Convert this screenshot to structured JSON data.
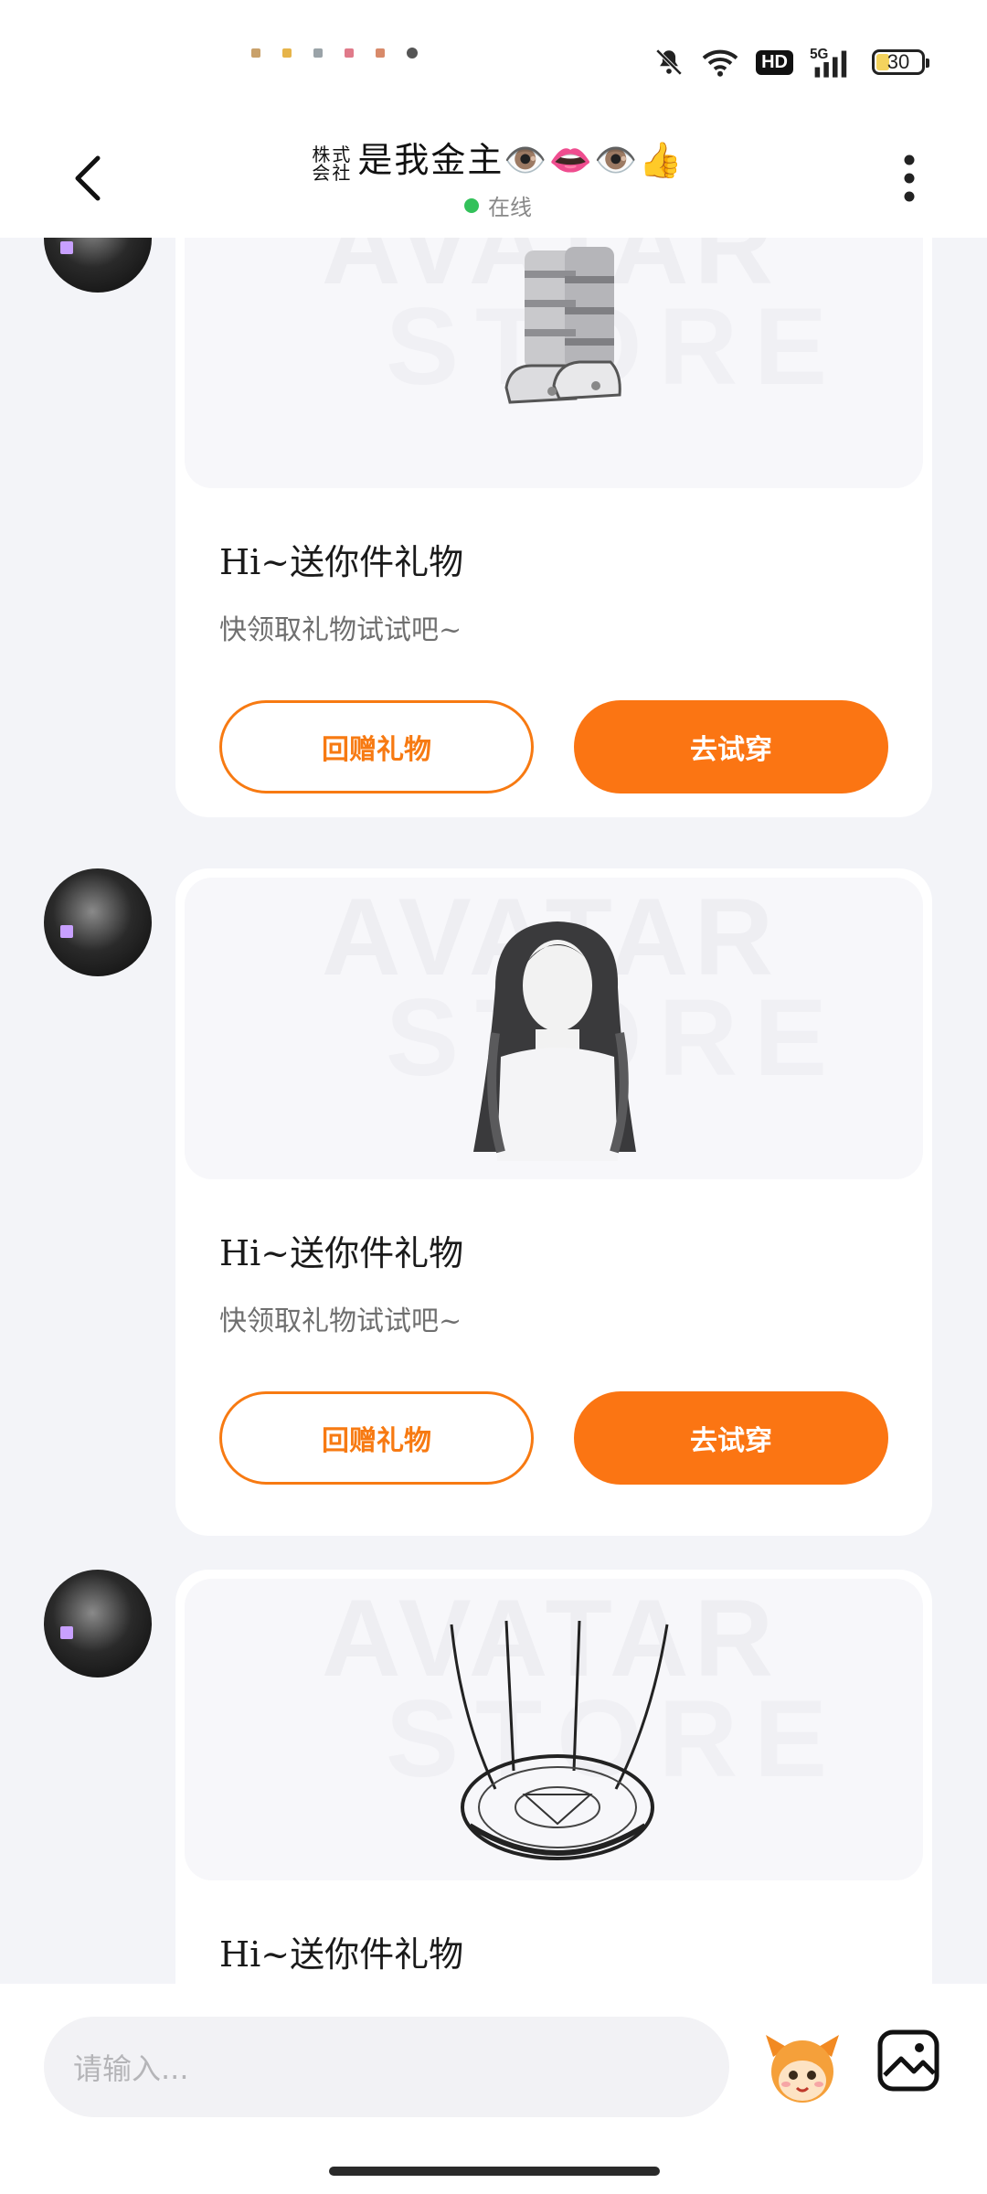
{
  "status_bar": {
    "battery_level": "30",
    "network": "5G",
    "hd_label": "HD"
  },
  "header": {
    "title_prefix_top": "株式",
    "title_prefix_bottom": "会社",
    "title": "是我金主👁️👄👁️👍",
    "online_status": "在线"
  },
  "messages": [
    {
      "item": "boots",
      "watermark_line1": "AVATAR",
      "watermark_line2": "STORE",
      "title": "Hi~送你件礼物",
      "subtitle": "快领取礼物试试吧~",
      "return_gift_label": "回赠礼物",
      "try_on_label": "去试穿"
    },
    {
      "item": "long-hair",
      "watermark_line1": "AVATAR",
      "watermark_line2": "STORE",
      "title": "Hi~送你件礼物",
      "subtitle": "快领取礼物试试吧~",
      "return_gift_label": "回赠礼物",
      "try_on_label": "去试穿"
    },
    {
      "item": "magic-circle",
      "watermark_line1": "AVATAR",
      "watermark_line2": "STORE",
      "title": "Hi~送你件礼物"
    }
  ],
  "input": {
    "placeholder": "请输入..."
  },
  "colors": {
    "accent": "#fb7513",
    "online": "#33c15a",
    "background": "#f3f4f8"
  }
}
